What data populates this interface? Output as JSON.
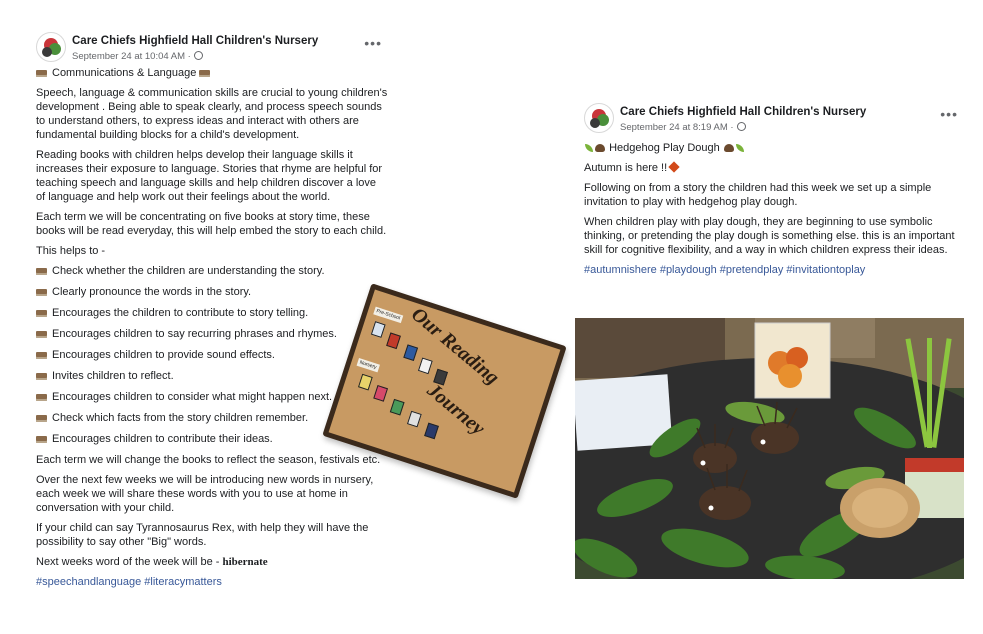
{
  "post_left": {
    "page_name": "Care Chiefs Highfield Hall Children's Nursery",
    "timestamp": "September 24 at 10:04 AM ·",
    "heading": "Communications & Language",
    "paragraphs": [
      "Speech, language & communication skills are crucial to young children's development . Being able to speak clearly, and process speech sounds to understand others, to express ideas and interact with others are fundamental building blocks for a child's development.",
      "Reading books with children helps develop their language skills it increases their exposure to language. Stories that rhyme are helpful for teaching speech and language skills and help children discover a love of language and help work out their feelings about the world.",
      "Each term we will be concentrating on five books at story time, these books will be read everyday, this will help embed the story to each child.",
      "This helps to -"
    ],
    "bullets": [
      "Check whether the children are understanding the story.",
      "Clearly pronounce the words in the story.",
      "Encourages the children to contribute to story telling.",
      "Encourages children to say recurring phrases and rhymes.",
      "Encourages children to provide sound effects.",
      "Invites children to reflect.",
      "Encourages children to consider what might happen next.",
      "Check which facts from the story children remember.",
      "Encourages children to contribute their ideas."
    ],
    "paragraphs_after": [
      "Each term we will change the books to reflect the season, festivals etc.",
      "Over the next few weeks we will be introducing new words in nursery, each week we will share these words with you to use at home in conversation with your child.",
      "If your child can say Tyrannosaurus Rex, with help they will have the possibility to say other \"Big\" words."
    ],
    "word_of_week_prefix": "Next weeks word of the week will be - ",
    "word_of_week": "hibernate",
    "hashtags": "#speechandlanguage #literacymatters",
    "image": {
      "title_line1": "Our Reading",
      "title_line2": "Journey",
      "tag_1": "Pre-School",
      "tag_2": "Nursery"
    }
  },
  "post_right": {
    "page_name": "Care Chiefs Highfield Hall Children's Nursery",
    "timestamp": "September 24 at 8:19 AM ·",
    "heading": "Hedgehog Play Dough",
    "line_autumn": "Autumn is here !!",
    "paragraphs": [
      "Following on from a story the children had this week we set up a simple invitation to play with hedgehog play dough.",
      "When children play with play dough, they are beginning to use symbolic thinking, or pretending the play dough is something else. this is an important skill for cognitive flexibility, and a way in which children express their ideas."
    ],
    "hashtags": "#autumnishere #playdough #pretendplay #invitationtoplay"
  },
  "icons": {
    "more": "more-options-icon",
    "globe": "globe-icon",
    "book": "books-emoji-icon",
    "hedgehog": "hedgehog-emoji-icon",
    "leaf": "herb-emoji-icon",
    "maple": "maple-leaf-emoji-icon"
  },
  "colors": {
    "hashtag": "#385898",
    "meta_text": "#65676b",
    "text": "#1c1e21"
  }
}
